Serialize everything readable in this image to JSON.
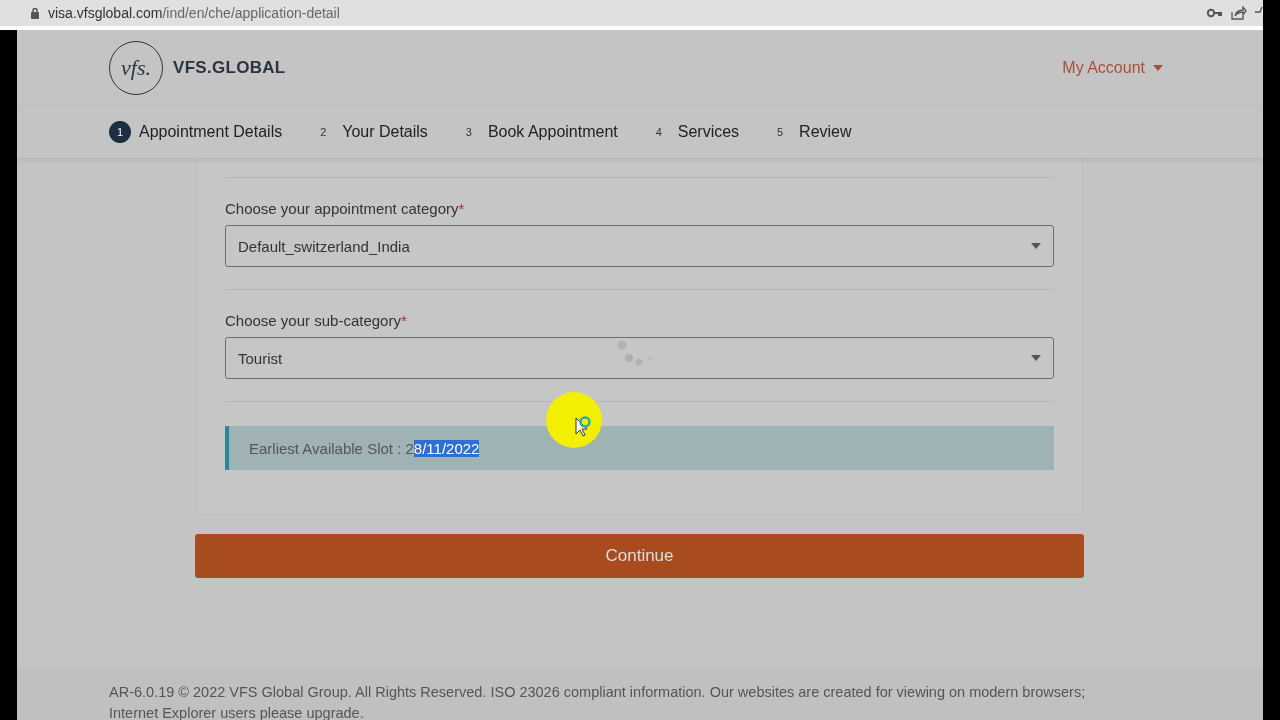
{
  "browser": {
    "url_host": "visa.vfsglobal.com",
    "url_path": "/ind/en/che/application-detail"
  },
  "header": {
    "brand": "VFS.GLOBAL",
    "logo_text": "vfs.",
    "account_menu": "My Account"
  },
  "steps": [
    {
      "number": "1",
      "label": "Appointment Details",
      "selected": true
    },
    {
      "number": "2",
      "label": "Your Details",
      "selected": false
    },
    {
      "number": "3",
      "label": "Book Appointment",
      "selected": false
    },
    {
      "number": "4",
      "label": "Services",
      "selected": false
    },
    {
      "number": "5",
      "label": "Review",
      "selected": false
    }
  ],
  "fields": [
    {
      "label": "Choose your appointment category",
      "required_mark": "*",
      "value": "Default_switzerland_India",
      "loading": false
    },
    {
      "label": "Choose your sub-category",
      "required_mark": "*",
      "value": "Tourist",
      "loading": true
    }
  ],
  "slot_notice": {
    "text": "Earliest Available Slot : 2",
    "highlighted": "8/11/2022"
  },
  "continue_button": "Continue",
  "footer": "AR-6.0.19 © 2022 VFS Global Group. All Rights Reserved. ISO 23026 compliant information. Our websites are created for viewing on modern browsers; Internet Explorer users please upgrade."
}
